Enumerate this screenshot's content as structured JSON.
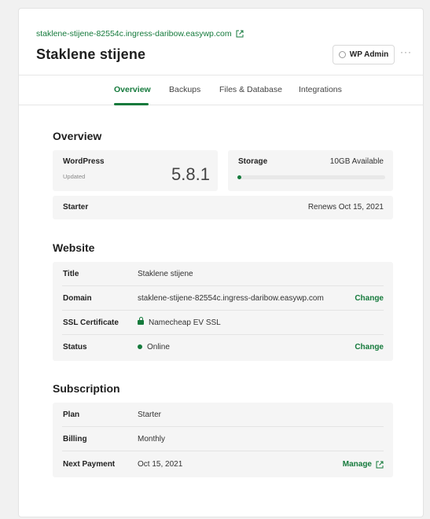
{
  "site": {
    "domain": "staklene-stijene-82554c.ingress-daribow.easywp.com",
    "title": "Staklene stijene",
    "wp_admin_label": "WP Admin",
    "more_label": "···"
  },
  "tabs": [
    {
      "label": "Overview",
      "active": true
    },
    {
      "label": "Backups",
      "active": false
    },
    {
      "label": "Files & Database",
      "active": false
    },
    {
      "label": "Integrations",
      "active": false
    }
  ],
  "overview": {
    "title": "Overview",
    "wordpress_label": "WordPress",
    "wordpress_status": "Updated",
    "wordpress_version": "5.8.1",
    "storage_label": "Storage",
    "storage_available": "10GB Available",
    "storage_used_fraction": 0.0,
    "plan_label": "Starter",
    "renews": "Renews Oct 15, 2021"
  },
  "website": {
    "title": "Website",
    "rows": [
      {
        "label": "Title",
        "value": "Staklene stijene",
        "action": ""
      },
      {
        "label": "Domain",
        "value": "staklene-stijene-82554c.ingress-daribow.easywp.com",
        "action": "Change"
      },
      {
        "label": "SSL Certificate",
        "value": "Namecheap EV SSL",
        "action": ""
      },
      {
        "label": "Status",
        "value": "Online",
        "action": "Change"
      }
    ]
  },
  "subscription": {
    "title": "Subscription",
    "rows": [
      {
        "label": "Plan",
        "value": "Starter",
        "action": ""
      },
      {
        "label": "Billing",
        "value": "Monthly",
        "action": ""
      },
      {
        "label": "Next Payment",
        "value": "Oct 15, 2021",
        "action": "Manage"
      }
    ]
  },
  "colors": {
    "accent": "#157a3c",
    "panel": "#f5f5f5"
  }
}
